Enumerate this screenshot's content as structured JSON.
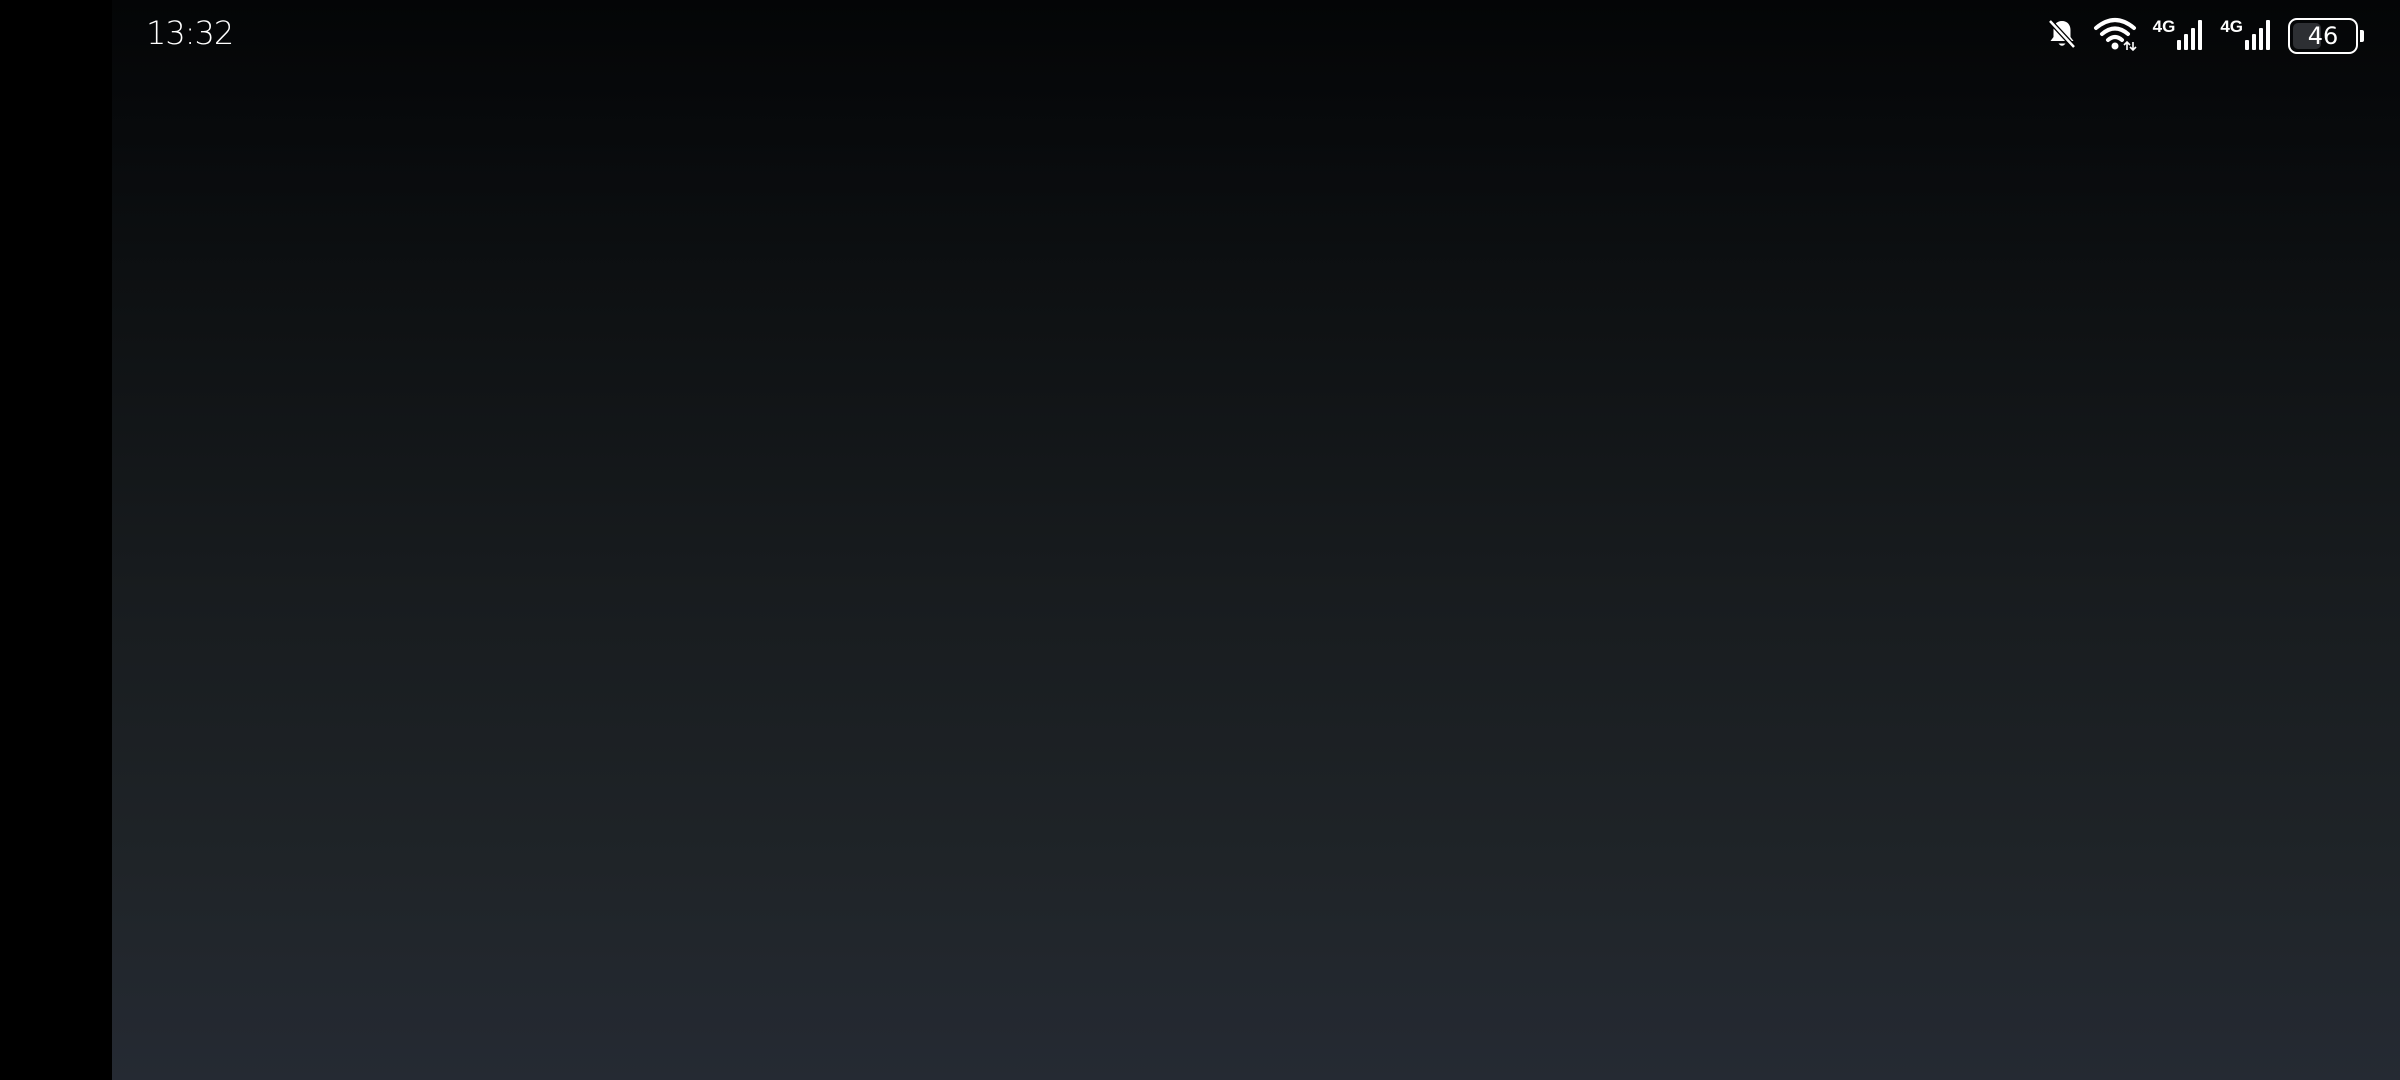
{
  "status_bar": {
    "time": "13:32",
    "icons": {
      "notifications": "bell-off-icon",
      "wifi": "wifi-icon",
      "cellular": "cellular-signal-icon",
      "battery": "battery-icon"
    },
    "network_1": {
      "type": "4G"
    },
    "network_2": {
      "type": "4G"
    },
    "battery": {
      "level": "46",
      "level_fraction": 0.46
    }
  },
  "colors": {
    "cutout": "#000000",
    "background_top": "#040506",
    "background_bottom": "#252a33",
    "status_text": "#ffffff"
  }
}
